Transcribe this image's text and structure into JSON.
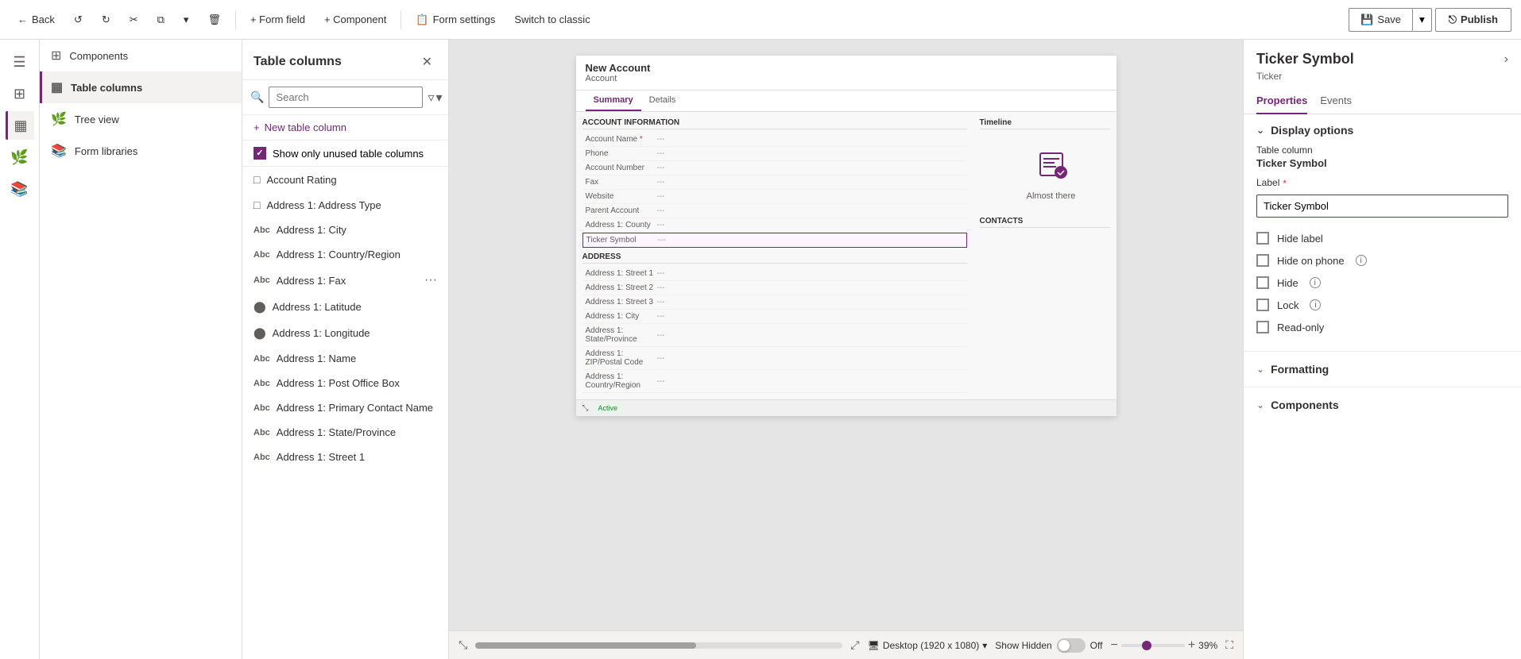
{
  "toolbar": {
    "back_label": "Back",
    "form_field_label": "+ Form field",
    "component_label": "+ Component",
    "form_settings_label": "Form settings",
    "switch_label": "Switch to classic",
    "save_label": "Save",
    "publish_label": "Publish"
  },
  "left_nav": {
    "menu_title": "Menu",
    "items": [
      {
        "id": "components",
        "label": "Components",
        "icon": "grid"
      },
      {
        "id": "table-columns",
        "label": "Table columns",
        "icon": "table",
        "active": true
      },
      {
        "id": "tree-view",
        "label": "Tree view",
        "icon": "tree"
      },
      {
        "id": "form-libraries",
        "label": "Form libraries",
        "icon": "library"
      }
    ]
  },
  "table_columns": {
    "title": "Table columns",
    "search_placeholder": "Search",
    "new_column_label": "New table column",
    "show_unused_label": "Show only unused table columns",
    "items": [
      {
        "id": "account-rating",
        "label": "Account Rating",
        "icon": "box",
        "has_more": false
      },
      {
        "id": "address-address-type",
        "label": "Address 1: Address Type",
        "icon": "box",
        "has_more": false
      },
      {
        "id": "address-city",
        "label": "Address 1: City",
        "icon": "abc",
        "has_more": false
      },
      {
        "id": "address-country",
        "label": "Address 1: Country/Region",
        "icon": "abc",
        "has_more": false
      },
      {
        "id": "address-fax",
        "label": "Address 1: Fax",
        "icon": "abc",
        "has_more": true
      },
      {
        "id": "address-latitude",
        "label": "Address 1: Latitude",
        "icon": "circle",
        "has_more": false
      },
      {
        "id": "address-longitude",
        "label": "Address 1: Longitude",
        "icon": "circle",
        "has_more": false
      },
      {
        "id": "address-name",
        "label": "Address 1: Name",
        "icon": "abc",
        "has_more": false
      },
      {
        "id": "address-po-box",
        "label": "Address 1: Post Office Box",
        "icon": "abc",
        "has_more": false
      },
      {
        "id": "address-primary-contact",
        "label": "Address 1: Primary Contact Name",
        "icon": "abc",
        "has_more": false
      },
      {
        "id": "address-state",
        "label": "Address 1: State/Province",
        "icon": "abc",
        "has_more": false
      },
      {
        "id": "address-street1",
        "label": "Address 1: Street 1",
        "icon": "abc",
        "has_more": false
      }
    ]
  },
  "form_preview": {
    "title": "New Account",
    "subtitle": "Account",
    "tabs": [
      "Summary",
      "Details"
    ],
    "active_tab": "Summary",
    "sections": {
      "account_info": {
        "title": "ACCOUNT INFORMATION",
        "rows": [
          {
            "label": "Account Name",
            "value": "---",
            "required": true
          },
          {
            "label": "Phone",
            "value": "---"
          },
          {
            "label": "Account Number",
            "value": "---"
          },
          {
            "label": "Fax",
            "value": "---"
          },
          {
            "label": "Website",
            "value": "---"
          },
          {
            "label": "Parent Account",
            "value": "---"
          },
          {
            "label": "Address 1: County",
            "value": "---"
          },
          {
            "label": "Ticker Symbol",
            "value": "---",
            "highlighted": true
          }
        ]
      },
      "address": {
        "title": "ADDRESS",
        "rows": [
          {
            "label": "Address 1: Street 1",
            "value": "---"
          },
          {
            "label": "Address 1: Street 2",
            "value": "---"
          },
          {
            "label": "Address 1: Street 3",
            "value": "---"
          },
          {
            "label": "Address 1: City",
            "value": "---"
          },
          {
            "label": "Address 1: State/Province",
            "value": "---"
          },
          {
            "label": "Address 1: ZIP/Postal Code",
            "value": "---"
          },
          {
            "label": "Address 1: Country/Region",
            "value": "---"
          }
        ]
      }
    },
    "timeline": "Timeline",
    "almost_there": "Almost there",
    "contacts_label": "CONTACTS",
    "active_label": "Active"
  },
  "canvas_bottom": {
    "desktop_label": "Desktop (1920 x 1080)",
    "show_hidden_label": "Show Hidden",
    "toggle_state": "Off",
    "zoom_percent": "39%"
  },
  "right_panel": {
    "title": "Ticker Symbol",
    "subtitle": "Ticker",
    "tabs": [
      "Properties",
      "Events"
    ],
    "active_tab": "Properties",
    "display_options": {
      "title": "Display options",
      "table_column_label": "Table column",
      "table_column_value": "Ticker Symbol",
      "label_label": "Label",
      "label_required": true,
      "label_value": "Ticker Symbol",
      "options": [
        {
          "id": "hide-label",
          "label": "Hide label",
          "checked": false,
          "has_info": false
        },
        {
          "id": "hide-on-phone",
          "label": "Hide on phone",
          "checked": false,
          "has_info": true
        },
        {
          "id": "hide",
          "label": "Hide",
          "checked": false,
          "has_info": true
        },
        {
          "id": "lock",
          "label": "Lock",
          "checked": false,
          "has_info": true
        },
        {
          "id": "read-only",
          "label": "Read-only",
          "checked": false,
          "has_info": false
        }
      ]
    },
    "formatting": {
      "title": "Formatting"
    },
    "components": {
      "title": "Components"
    }
  }
}
